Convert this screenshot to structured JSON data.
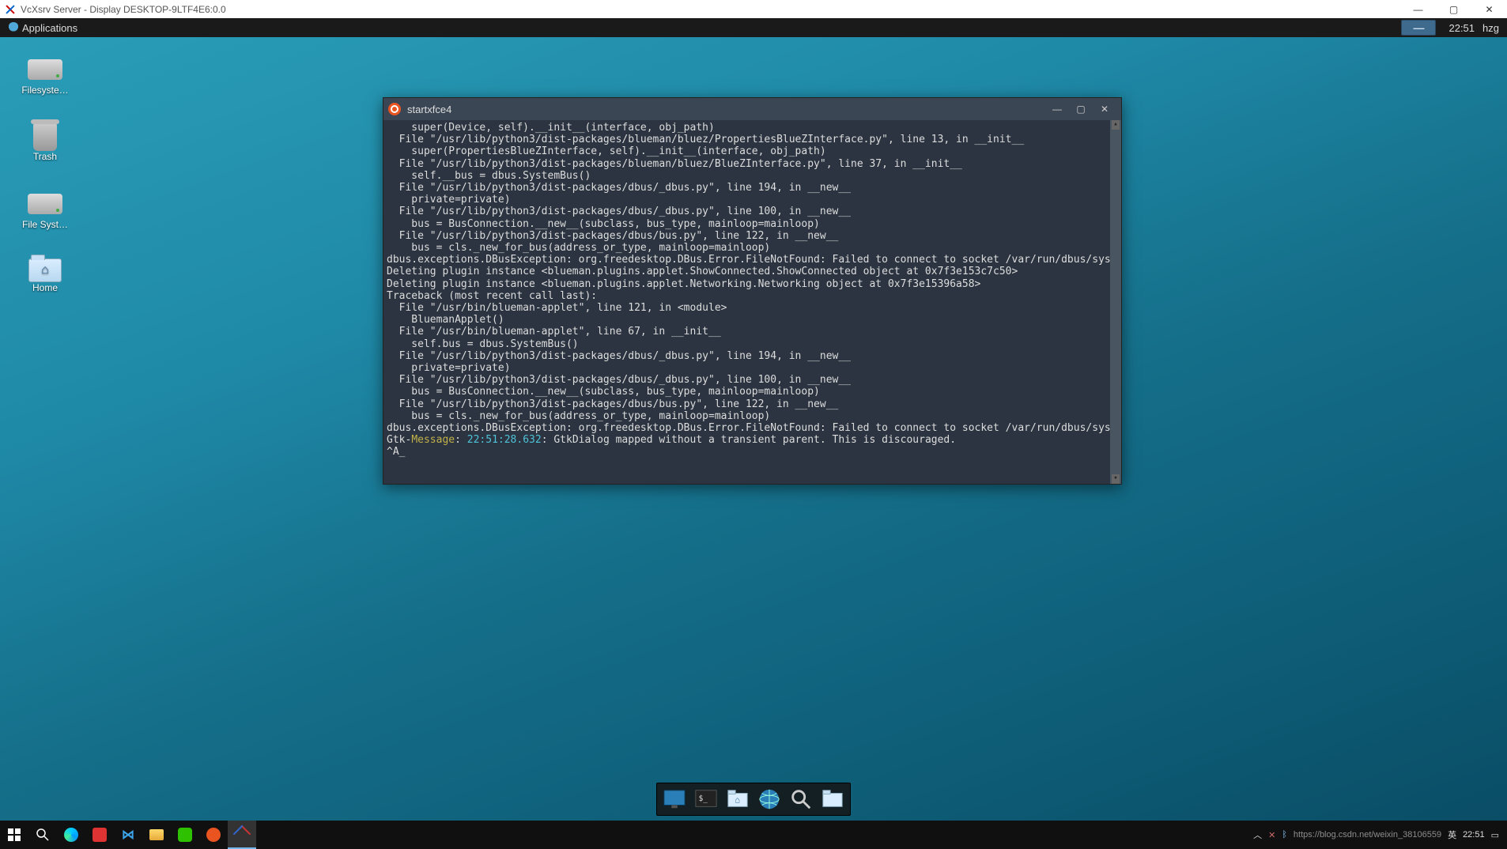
{
  "windows_title": "VcXsrv Server - Display DESKTOP-9LTF4E6:0.0",
  "xfce_panel": {
    "applications_label": "Applications",
    "clock": "22:51",
    "user": "hzg"
  },
  "desktop_icons": {
    "filesystem": "Filesyste…",
    "trash": "Trash",
    "file_syst": "File Syst…",
    "home": "Home"
  },
  "terminal": {
    "title": "startxfce4",
    "lines": [
      "    super(Device, self).__init__(interface, obj_path)",
      "  File \"/usr/lib/python3/dist-packages/blueman/bluez/PropertiesBlueZInterface.py\", line 13, in __init__",
      "    super(PropertiesBlueZInterface, self).__init__(interface, obj_path)",
      "  File \"/usr/lib/python3/dist-packages/blueman/bluez/BlueZInterface.py\", line 37, in __init__",
      "    self.__bus = dbus.SystemBus()",
      "  File \"/usr/lib/python3/dist-packages/dbus/_dbus.py\", line 194, in __new__",
      "    private=private)",
      "  File \"/usr/lib/python3/dist-packages/dbus/_dbus.py\", line 100, in __new__",
      "    bus = BusConnection.__new__(subclass, bus_type, mainloop=mainloop)",
      "  File \"/usr/lib/python3/dist-packages/dbus/bus.py\", line 122, in __new__",
      "    bus = cls._new_for_bus(address_or_type, mainloop=mainloop)",
      "dbus.exceptions.DBusException: org.freedesktop.DBus.Error.FileNotFound: Failed to connect to socket /var/run/dbus/system_bus_socket: No such file or directory",
      "Deleting plugin instance <blueman.plugins.applet.ShowConnected.ShowConnected object at 0x7f3e153c7c50>",
      "Deleting plugin instance <blueman.plugins.applet.Networking.Networking object at 0x7f3e15396a58>",
      "Traceback (most recent call last):",
      "  File \"/usr/bin/blueman-applet\", line 121, in <module>",
      "    BluemanApplet()",
      "  File \"/usr/bin/blueman-applet\", line 67, in __init__",
      "    self.bus = dbus.SystemBus()",
      "  File \"/usr/lib/python3/dist-packages/dbus/_dbus.py\", line 194, in __new__",
      "    private=private)",
      "  File \"/usr/lib/python3/dist-packages/dbus/_dbus.py\", line 100, in __new__",
      "    bus = BusConnection.__new__(subclass, bus_type, mainloop=mainloop)",
      "  File \"/usr/lib/python3/dist-packages/dbus/bus.py\", line 122, in __new__",
      "    bus = cls._new_for_bus(address_or_type, mainloop=mainloop)",
      "dbus.exceptions.DBusException: org.freedesktop.DBus.Error.FileNotFound: Failed to connect to socket /var/run/dbus/system_bus_socket: No such file or directory"
    ],
    "gtk_prefix": "Gtk-",
    "gtk_message_word": "Message",
    "gtk_colon": ": ",
    "gtk_timestamp": "22:51:28.632",
    "gtk_rest": ": GtkDialog mapped without a transient parent. This is discouraged.",
    "prompt_line": "^A_"
  },
  "dock_items": [
    "desktop",
    "terminal",
    "file-manager",
    "web-browser",
    "search",
    "folder"
  ],
  "win_taskbar": {
    "tray_text": "https://blog.csdn.net/weixin_38106559",
    "ime": "英",
    "clock": "22:51"
  }
}
